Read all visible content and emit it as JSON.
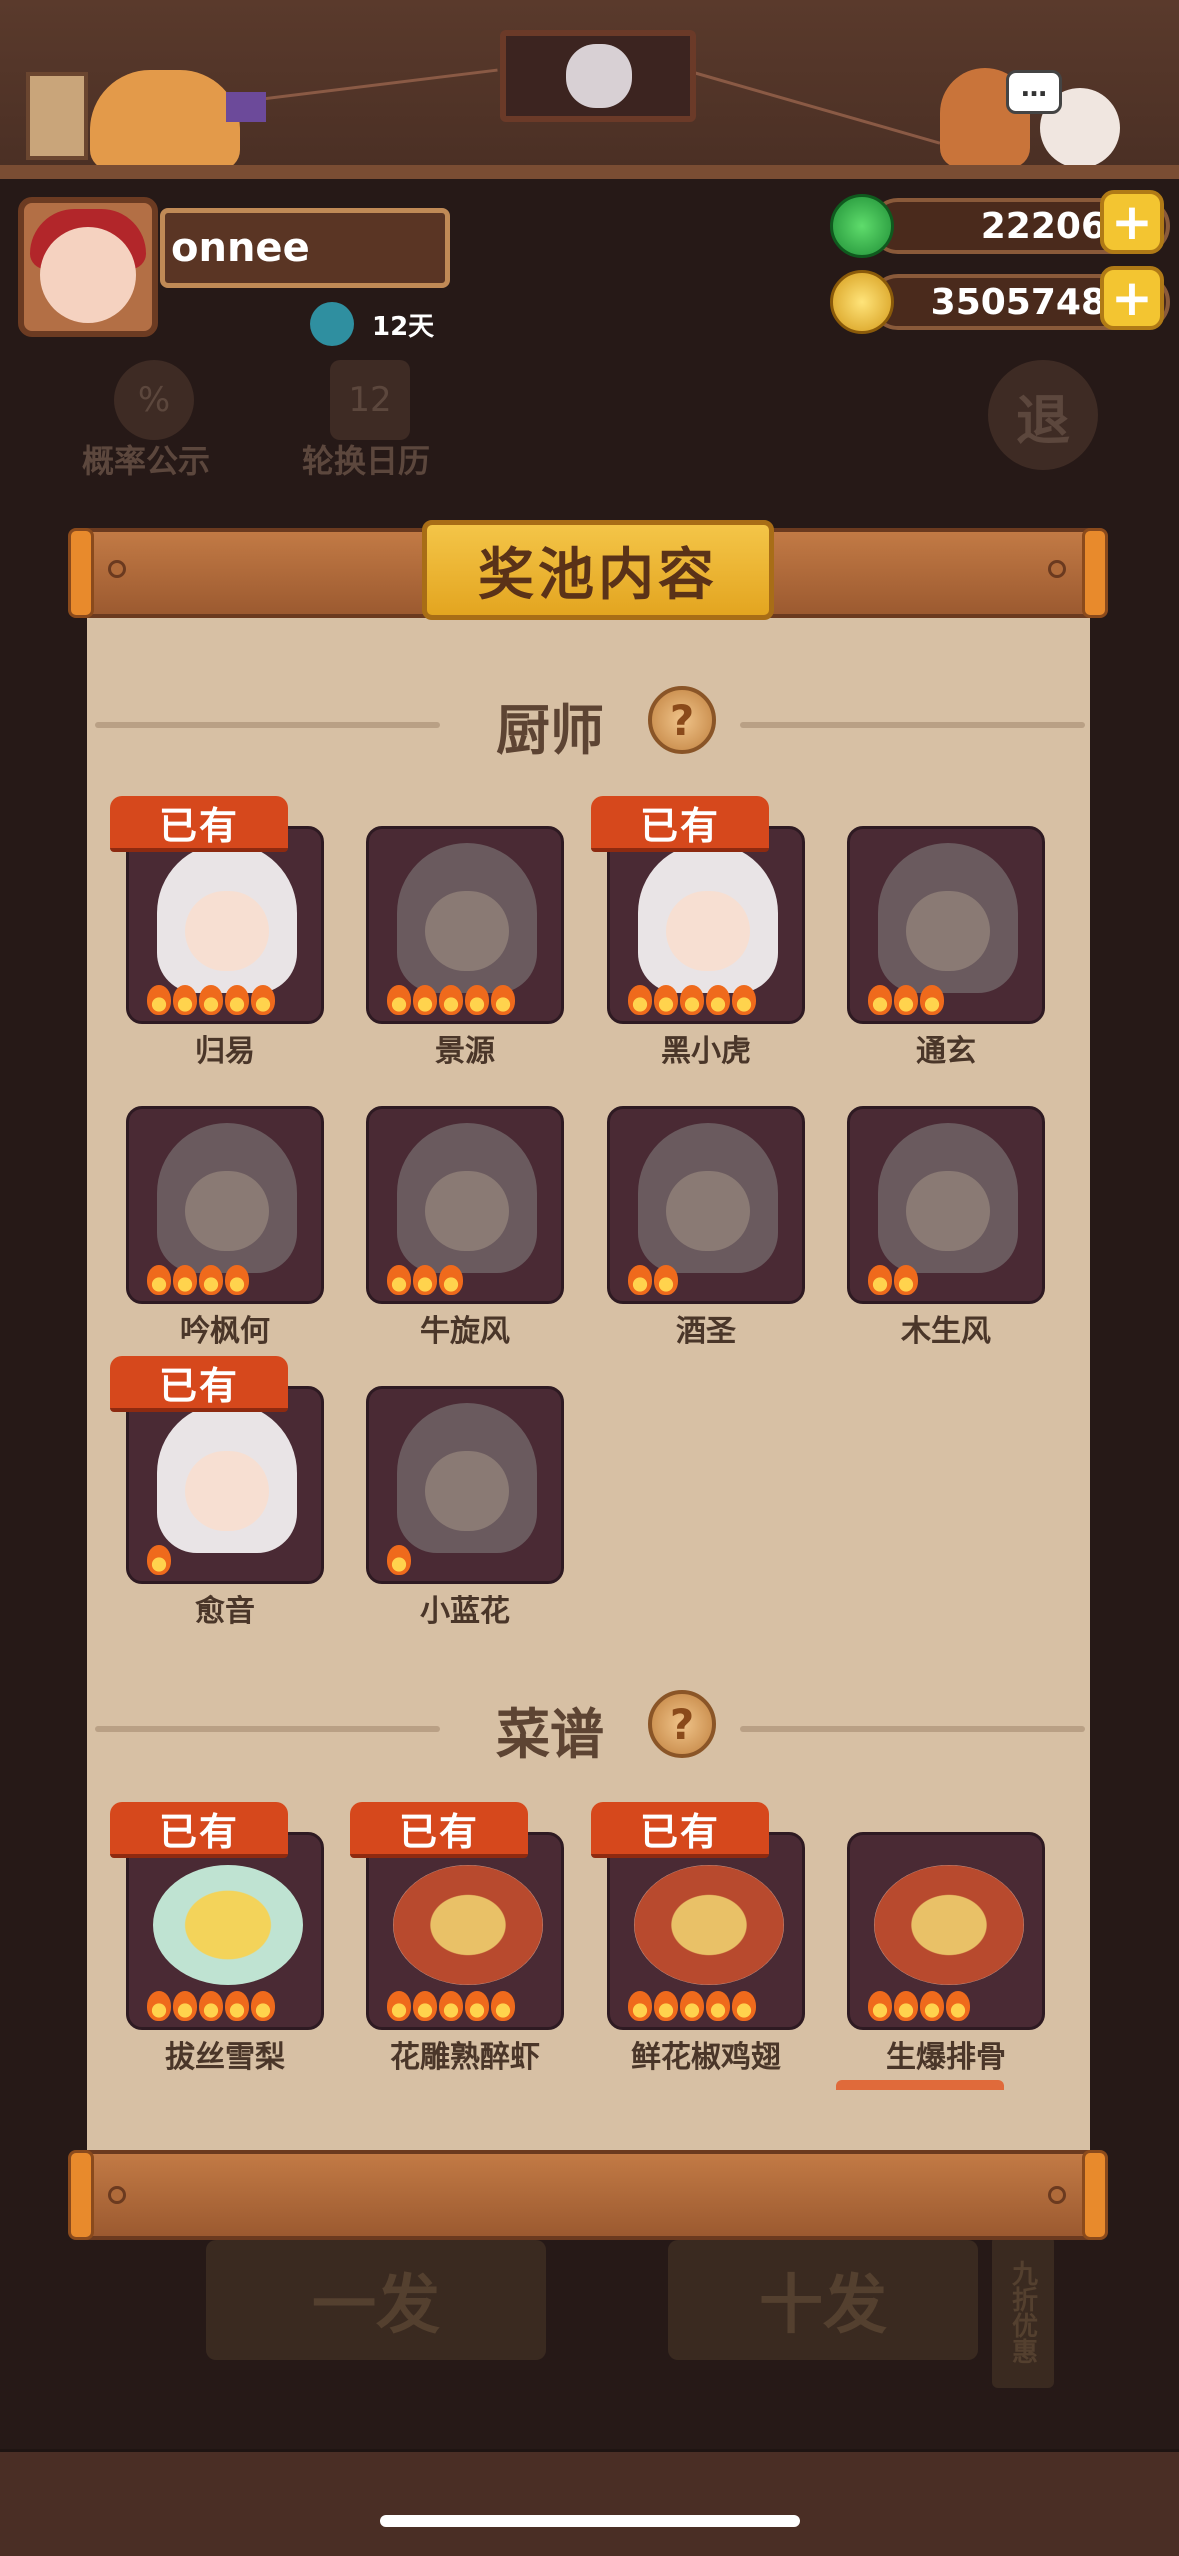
{
  "player": {
    "name": "onnee",
    "days": "12天"
  },
  "currencies": [
    {
      "icon": "jade-icon",
      "value": "22206",
      "color": "#2db44a"
    },
    {
      "icon": "coin-icon",
      "value": "3505748",
      "color": "#e9b328"
    }
  ],
  "background": {
    "probability": "概率公示",
    "calendar": "轮换日历",
    "exit": "退",
    "draw_one": "一发",
    "draw_ten": "十发",
    "discount": "九折优惠"
  },
  "modal": {
    "title": "奖池内容",
    "owned_label": "已有",
    "sections": [
      {
        "title": "厨师",
        "items": [
          {
            "name": "归易",
            "owned": true,
            "stars": 5
          },
          {
            "name": "景源",
            "owned": false,
            "stars": 5
          },
          {
            "name": "黑小虎",
            "owned": true,
            "stars": 5
          },
          {
            "name": "通玄",
            "owned": false,
            "stars": 3
          },
          {
            "name": "吟枫何",
            "owned": false,
            "stars": 4
          },
          {
            "name": "牛旋风",
            "owned": false,
            "stars": 3
          },
          {
            "name": "酒圣",
            "owned": false,
            "stars": 2
          },
          {
            "name": "木生风",
            "owned": false,
            "stars": 2
          },
          {
            "name": "愈音",
            "owned": true,
            "stars": 1
          },
          {
            "name": "小蓝花",
            "owned": false,
            "stars": 1
          }
        ]
      },
      {
        "title": "菜谱",
        "items": [
          {
            "name": "拔丝雪梨",
            "owned": true,
            "stars": 5
          },
          {
            "name": "花雕熟醉虾",
            "owned": true,
            "stars": 5
          },
          {
            "name": "鲜花椒鸡翅",
            "owned": true,
            "stars": 5
          },
          {
            "name": "生爆排骨",
            "owned": false,
            "stars": 4
          }
        ]
      }
    ]
  }
}
